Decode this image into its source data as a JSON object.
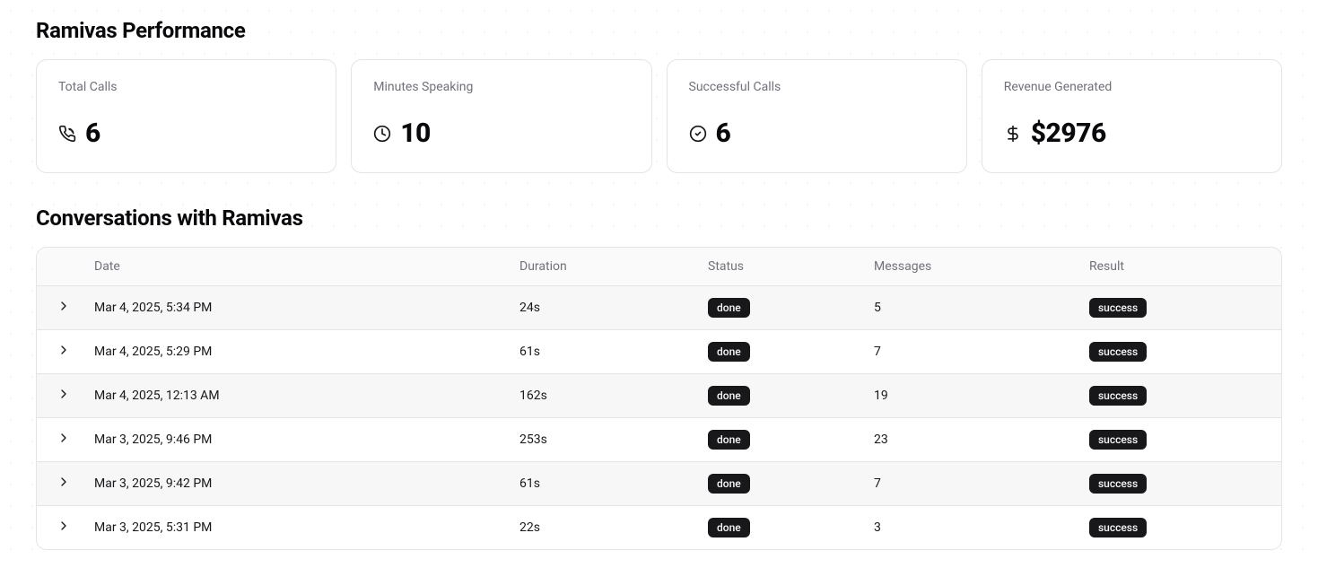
{
  "performance": {
    "title": "Ramivas Performance",
    "cards": [
      {
        "title": "Total Calls",
        "value": "6",
        "icon": "phone-call-icon"
      },
      {
        "title": "Minutes Speaking",
        "value": "10",
        "icon": "clock-icon"
      },
      {
        "title": "Successful Calls",
        "value": "6",
        "icon": "check-circle-icon"
      },
      {
        "title": "Revenue Generated",
        "value": "$2976",
        "icon": "dollar-icon"
      }
    ]
  },
  "conversations": {
    "title": "Conversations with Ramivas",
    "columns": {
      "date": "Date",
      "duration": "Duration",
      "status": "Status",
      "messages": "Messages",
      "result": "Result"
    },
    "rows": [
      {
        "date": "Mar 4, 2025, 5:34 PM",
        "duration": "24s",
        "status": "done",
        "messages": "5",
        "result": "success"
      },
      {
        "date": "Mar 4, 2025, 5:29 PM",
        "duration": "61s",
        "status": "done",
        "messages": "7",
        "result": "success"
      },
      {
        "date": "Mar 4, 2025, 12:13 AM",
        "duration": "162s",
        "status": "done",
        "messages": "19",
        "result": "success"
      },
      {
        "date": "Mar 3, 2025, 9:46 PM",
        "duration": "253s",
        "status": "done",
        "messages": "23",
        "result": "success"
      },
      {
        "date": "Mar 3, 2025, 9:42 PM",
        "duration": "61s",
        "status": "done",
        "messages": "7",
        "result": "success"
      },
      {
        "date": "Mar 3, 2025, 5:31 PM",
        "duration": "22s",
        "status": "done",
        "messages": "3",
        "result": "success"
      }
    ]
  }
}
